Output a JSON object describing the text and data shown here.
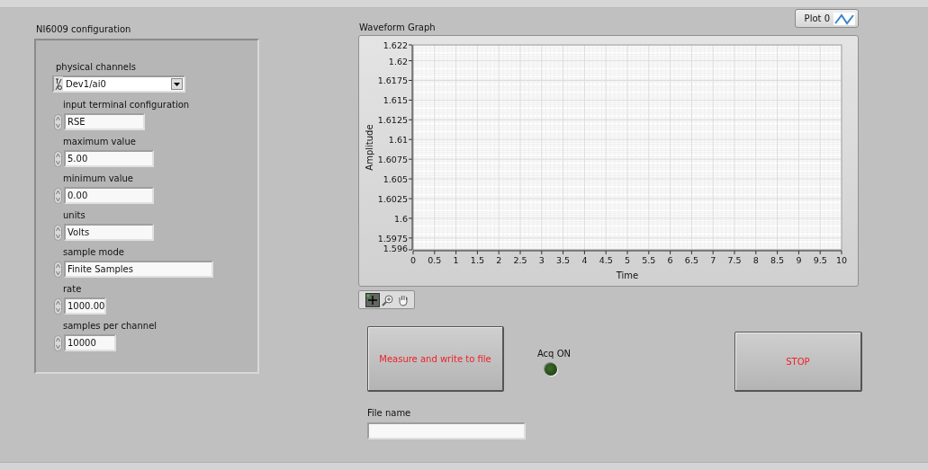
{
  "config_panel": {
    "title": "NI6009 configuration",
    "controls": [
      {
        "kind": "ring",
        "label": "physical channels",
        "value": "Dev1/ai0"
      },
      {
        "kind": "spin",
        "label": "input terminal configuration",
        "value": "RSE"
      },
      {
        "kind": "spin",
        "label": "maximum value",
        "value": "5.00"
      },
      {
        "kind": "spin",
        "label": "minimum value",
        "value": "0.00"
      },
      {
        "kind": "spin",
        "label": "units",
        "value": "Volts"
      },
      {
        "kind": "spin",
        "label": "sample mode",
        "value": "Finite Samples"
      },
      {
        "kind": "spin",
        "label": "rate",
        "value": "1000.00"
      },
      {
        "kind": "spin",
        "label": "samples per channel",
        "value": "10000"
      }
    ]
  },
  "graph": {
    "title": "Waveform Graph",
    "legend": {
      "label": "Plot 0",
      "color": "#3c84c8"
    },
    "chart_data": {
      "type": "line",
      "grid": true,
      "xlabel": "Time",
      "ylabel": "Amplitude",
      "xlim": [
        0,
        10
      ],
      "ylim": [
        1.596,
        1.622
      ],
      "xticks": [
        0,
        0.5,
        1,
        1.5,
        2,
        2.5,
        3,
        3.5,
        4,
        4.5,
        5,
        5.5,
        6,
        6.5,
        7,
        7.5,
        8,
        8.5,
        9,
        9.5,
        10
      ],
      "yticks": [
        1.596,
        1.5975,
        1.6,
        1.6025,
        1.605,
        1.6075,
        1.61,
        1.6125,
        1.615,
        1.6175,
        1.62,
        1.622
      ]
    },
    "tools": [
      {
        "kind": "cursor",
        "selected": true
      },
      {
        "kind": "zoom",
        "selected": false
      },
      {
        "kind": "pan",
        "selected": false
      }
    ]
  },
  "measure_button": {
    "label": "Measure and write to file"
  },
  "indicator": {
    "label": "Acq ON",
    "lit": false
  },
  "stop_button": {
    "label": "STOP"
  },
  "file_name": {
    "label": "File name"
  }
}
